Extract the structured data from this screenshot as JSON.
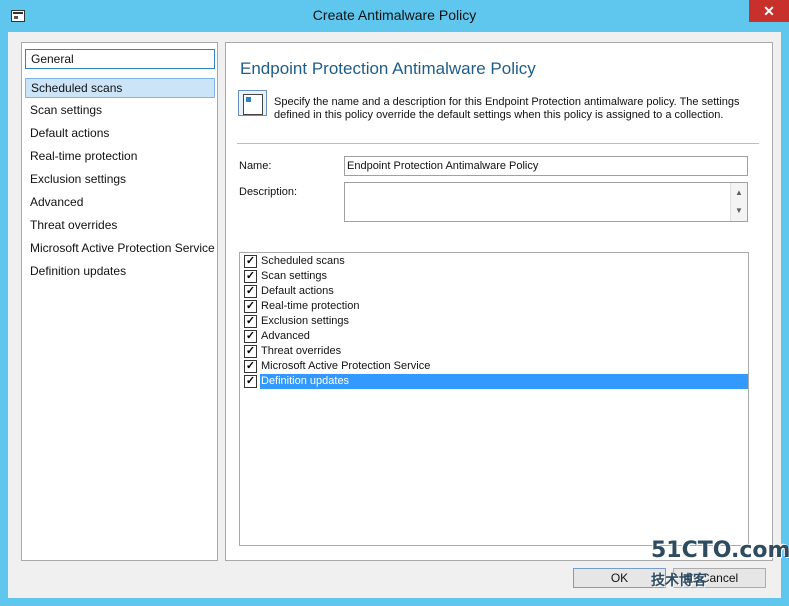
{
  "window": {
    "title": "Create Antimalware Policy",
    "close_glyph": "✕"
  },
  "nav": {
    "items": [
      {
        "label": "General"
      },
      {
        "label": "Scheduled scans"
      },
      {
        "label": "Scan settings"
      },
      {
        "label": "Default actions"
      },
      {
        "label": "Real-time protection"
      },
      {
        "label": "Exclusion settings"
      },
      {
        "label": "Advanced"
      },
      {
        "label": "Threat overrides"
      },
      {
        "label": "Microsoft Active Protection Service"
      },
      {
        "label": "Definition updates"
      }
    ],
    "focused": "General",
    "selected": "Scheduled scans"
  },
  "content": {
    "heading": "Endpoint Protection Antimalware Policy",
    "intro": "Specify the name and a description for this Endpoint Protection antimalware policy. The settings defined in this policy override the default settings when this policy is assigned to a collection.",
    "name_label": "Name:",
    "name_value": "Endpoint Protection Antimalware Policy",
    "description_label": "Description:",
    "description_value": "",
    "settings": [
      {
        "label": "Scheduled scans",
        "checked": true
      },
      {
        "label": "Scan settings",
        "checked": true
      },
      {
        "label": "Default actions",
        "checked": true
      },
      {
        "label": "Real-time protection",
        "checked": true
      },
      {
        "label": "Exclusion settings",
        "checked": true
      },
      {
        "label": "Advanced",
        "checked": true
      },
      {
        "label": "Threat overrides",
        "checked": true
      },
      {
        "label": "Microsoft Active Protection Service",
        "checked": true
      },
      {
        "label": "Definition updates",
        "checked": true
      }
    ],
    "selected_setting": "Definition updates",
    "check_glyph": "✓"
  },
  "buttons": {
    "ok": "OK",
    "cancel": "Cancel"
  },
  "watermark": {
    "line1": "51CTO.com",
    "line2": "技术博客"
  },
  "colors": {
    "title_bar": "#5fc6ee",
    "close_button": "#c7302b",
    "heading": "#1e5d88",
    "selection": "#3399ff",
    "nav_selection": "#cce4f7"
  }
}
